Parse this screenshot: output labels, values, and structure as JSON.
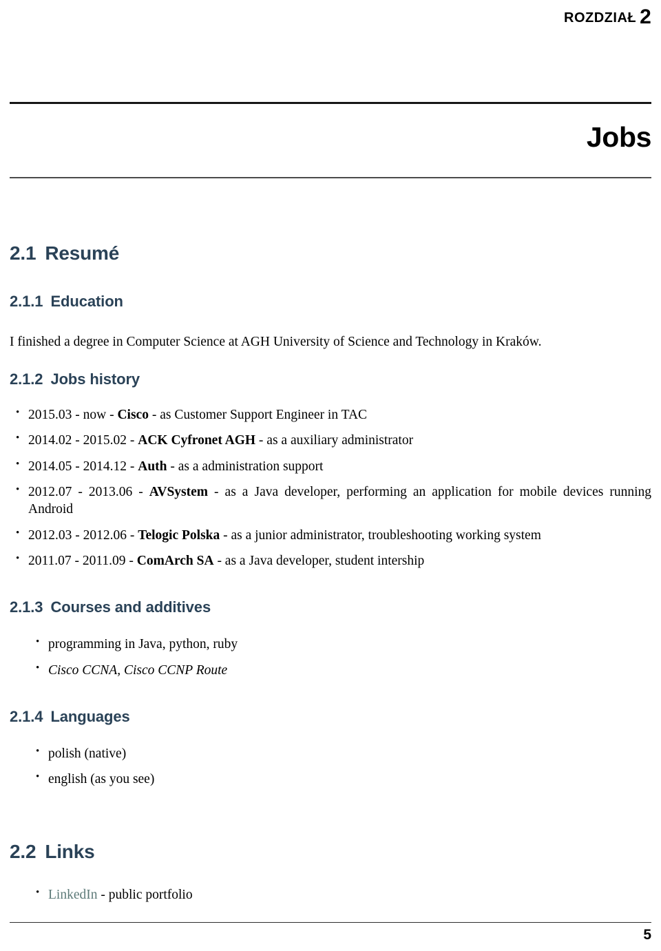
{
  "header": {
    "chapter_word": "ROZDZIAŁ",
    "chapter_number": "2",
    "chapter_title": "Jobs"
  },
  "sections": {
    "resume": {
      "number": "2.1",
      "title": "Resumé"
    },
    "education": {
      "number": "2.1.1",
      "title": "Education",
      "paragraph": "I finished a degree in Computer Science at AGH University of Science and Technology in Kraków."
    },
    "jobs_history": {
      "number": "2.1.2",
      "title": "Jobs history",
      "items": [
        {
          "period": "2015.03 - now - ",
          "company": "Cisco",
          "role": " - as Customer Support Engineer in TAC"
        },
        {
          "period": "2014.02 - 2015.02 - ",
          "company": "ACK Cyfronet AGH",
          "role": " - as a auxiliary administrator"
        },
        {
          "period": "2014.05 - 2014.12 - ",
          "company": "Auth",
          "role": " - as a administration support"
        },
        {
          "period": "2012.07 - 2013.06 - ",
          "company": "AVSystem",
          "role": " - as a Java developer, performing an application for mobile devices running Android"
        },
        {
          "period": "2012.03 - 2012.06 - ",
          "company": "Telogic Polska",
          "role": " - as a junior administrator, troubleshooting working system"
        },
        {
          "period": "2011.07 - 2011.09 - ",
          "company": "ComArch SA",
          "role": " - as a Java developer, student intership"
        }
      ]
    },
    "courses": {
      "number": "2.1.3",
      "title": "Courses and additives",
      "items": [
        {
          "text": "programming in Java, python, ruby",
          "italic": false
        },
        {
          "text": "Cisco CCNA, Cisco CCNP Route",
          "italic": true
        }
      ]
    },
    "languages": {
      "number": "2.1.4",
      "title": "Languages",
      "items": [
        {
          "text": "polish (native)"
        },
        {
          "text": "english (as you see)"
        }
      ]
    },
    "links": {
      "number": "2.2",
      "title": "Links",
      "items": [
        {
          "link_text": "LinkedIn",
          "suffix": " - public portfolio"
        }
      ]
    }
  },
  "footer": {
    "page_number": "5"
  },
  "colors": {
    "heading": "#2a4257",
    "link": "#5d7a78",
    "rule_dark": "#161616",
    "rule_gray": "#4a4a4a"
  }
}
